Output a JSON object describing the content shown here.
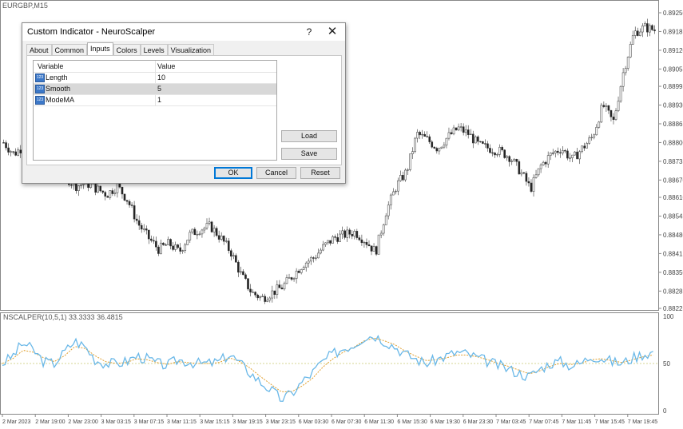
{
  "chart": {
    "symbol": "EURGBP,M15",
    "price_ticks": [
      "0.89250",
      "0.89185",
      "0.89120",
      "0.89055",
      "0.88995",
      "0.88930",
      "0.88865",
      "0.88800",
      "0.88735",
      "0.88670",
      "0.88610",
      "0.88545",
      "0.88480",
      "0.88415",
      "0.88350",
      "0.88285",
      "0.88225"
    ],
    "time_ticks": [
      "2 Mar 2023",
      "2 Mar 19:00",
      "2 Mar 23:00",
      "3 Mar 03:15",
      "3 Mar 07:15",
      "3 Mar 11:15",
      "3 Mar 15:15",
      "3 Mar 19:15",
      "3 Mar 23:15",
      "6 Mar 03:30",
      "6 Mar 07:30",
      "6 Mar 11:30",
      "6 Mar 15:30",
      "6 Mar 19:30",
      "6 Mar 23:30",
      "7 Mar 03:45",
      "7 Mar 07:45",
      "7 Mar 11:45",
      "7 Mar 15:45",
      "7 Mar 19:45"
    ],
    "indicator_label": "NSCALPER(10,5,1) 33.3333 36.4815",
    "indicator_ticks": [
      "100",
      "50",
      "0"
    ],
    "close_path": [
      0.888,
      0.8876,
      0.8879,
      0.887,
      0.8872,
      0.8869,
      0.8868,
      0.8865,
      0.8866,
      0.8864,
      0.8862,
      0.8865,
      0.886,
      0.8852,
      0.8847,
      0.8843,
      0.8845,
      0.8842,
      0.8848,
      0.885,
      0.8851,
      0.8847,
      0.8842,
      0.8834,
      0.8828,
      0.8826,
      0.8828,
      0.883,
      0.8834,
      0.8838,
      0.884,
      0.8844,
      0.8847,
      0.8848,
      0.8849,
      0.8846,
      0.8842,
      0.8856,
      0.8865,
      0.887,
      0.8883,
      0.8881,
      0.8878,
      0.8882,
      0.8885,
      0.8883,
      0.8879,
      0.8878,
      0.8877,
      0.8875,
      0.887,
      0.8864,
      0.8872,
      0.8876,
      0.8878,
      0.8874,
      0.8878,
      0.8882,
      0.8893,
      0.8887,
      0.8905,
      0.8918,
      0.892,
      0.8919
    ],
    "osc_path": [
      50,
      58,
      72,
      64,
      52,
      50,
      62,
      74,
      68,
      54,
      50,
      50,
      52,
      58,
      55,
      50,
      48,
      54,
      52,
      50,
      50,
      52,
      60,
      50,
      40,
      30,
      22,
      12,
      18,
      30,
      40,
      52,
      60,
      66,
      70,
      78,
      80,
      74,
      68,
      60,
      55,
      50,
      54,
      58,
      62,
      60,
      56,
      52,
      48,
      44,
      40,
      36,
      44,
      50,
      52,
      48,
      50,
      58,
      56,
      52,
      50,
      56,
      60,
      62
    ],
    "signal_path": [
      50,
      55,
      64,
      62,
      56,
      52,
      58,
      68,
      66,
      58,
      52,
      50,
      51,
      55,
      54,
      51,
      49,
      52,
      51,
      50,
      50,
      51,
      56,
      52,
      45,
      36,
      28,
      20,
      20,
      26,
      34,
      46,
      55,
      62,
      67,
      74,
      77,
      74,
      70,
      63,
      58,
      53,
      54,
      56,
      59,
      59,
      57,
      54,
      50,
      47,
      43,
      39,
      42,
      47,
      50,
      49,
      50,
      54,
      55,
      53,
      51,
      54,
      57,
      59
    ]
  },
  "dialog": {
    "title": "Custom Indicator - NeuroScalper",
    "help": "?",
    "close": "✕",
    "tabs": [
      "About",
      "Common",
      "Inputs",
      "Colors",
      "Levels",
      "Visualization"
    ],
    "active_tab": "Inputs",
    "grid": {
      "col_variable": "Variable",
      "col_value": "Value",
      "rows": [
        {
          "name": "Length",
          "value": "10",
          "icon": "int-icon"
        },
        {
          "name": "Smooth",
          "value": "5",
          "icon": "int-icon"
        },
        {
          "name": "ModeMA",
          "value": "1",
          "icon": "int-icon"
        }
      ]
    },
    "load": "Load",
    "save": "Save",
    "ok": "OK",
    "cancel": "Cancel",
    "reset": "Reset"
  }
}
